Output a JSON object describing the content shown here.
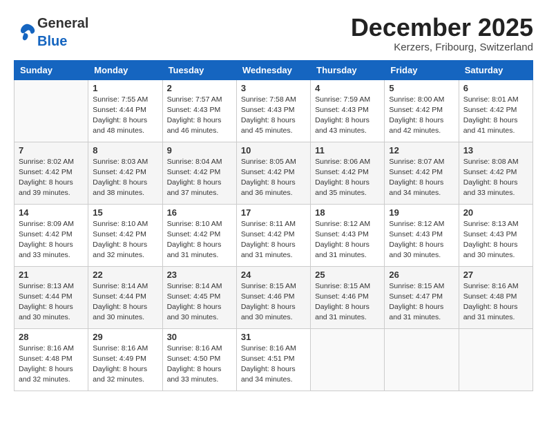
{
  "logo": {
    "general": "General",
    "blue": "Blue"
  },
  "header": {
    "month": "December 2025",
    "location": "Kerzers, Fribourg, Switzerland"
  },
  "weekdays": [
    "Sunday",
    "Monday",
    "Tuesday",
    "Wednesday",
    "Thursday",
    "Friday",
    "Saturday"
  ],
  "weeks": [
    [
      {
        "day": "",
        "sunrise": "",
        "sunset": "",
        "daylight": ""
      },
      {
        "day": "1",
        "sunrise": "Sunrise: 7:55 AM",
        "sunset": "Sunset: 4:44 PM",
        "daylight": "Daylight: 8 hours and 48 minutes."
      },
      {
        "day": "2",
        "sunrise": "Sunrise: 7:57 AM",
        "sunset": "Sunset: 4:43 PM",
        "daylight": "Daylight: 8 hours and 46 minutes."
      },
      {
        "day": "3",
        "sunrise": "Sunrise: 7:58 AM",
        "sunset": "Sunset: 4:43 PM",
        "daylight": "Daylight: 8 hours and 45 minutes."
      },
      {
        "day": "4",
        "sunrise": "Sunrise: 7:59 AM",
        "sunset": "Sunset: 4:43 PM",
        "daylight": "Daylight: 8 hours and 43 minutes."
      },
      {
        "day": "5",
        "sunrise": "Sunrise: 8:00 AM",
        "sunset": "Sunset: 4:42 PM",
        "daylight": "Daylight: 8 hours and 42 minutes."
      },
      {
        "day": "6",
        "sunrise": "Sunrise: 8:01 AM",
        "sunset": "Sunset: 4:42 PM",
        "daylight": "Daylight: 8 hours and 41 minutes."
      }
    ],
    [
      {
        "day": "7",
        "sunrise": "Sunrise: 8:02 AM",
        "sunset": "Sunset: 4:42 PM",
        "daylight": "Daylight: 8 hours and 39 minutes."
      },
      {
        "day": "8",
        "sunrise": "Sunrise: 8:03 AM",
        "sunset": "Sunset: 4:42 PM",
        "daylight": "Daylight: 8 hours and 38 minutes."
      },
      {
        "day": "9",
        "sunrise": "Sunrise: 8:04 AM",
        "sunset": "Sunset: 4:42 PM",
        "daylight": "Daylight: 8 hours and 37 minutes."
      },
      {
        "day": "10",
        "sunrise": "Sunrise: 8:05 AM",
        "sunset": "Sunset: 4:42 PM",
        "daylight": "Daylight: 8 hours and 36 minutes."
      },
      {
        "day": "11",
        "sunrise": "Sunrise: 8:06 AM",
        "sunset": "Sunset: 4:42 PM",
        "daylight": "Daylight: 8 hours and 35 minutes."
      },
      {
        "day": "12",
        "sunrise": "Sunrise: 8:07 AM",
        "sunset": "Sunset: 4:42 PM",
        "daylight": "Daylight: 8 hours and 34 minutes."
      },
      {
        "day": "13",
        "sunrise": "Sunrise: 8:08 AM",
        "sunset": "Sunset: 4:42 PM",
        "daylight": "Daylight: 8 hours and 33 minutes."
      }
    ],
    [
      {
        "day": "14",
        "sunrise": "Sunrise: 8:09 AM",
        "sunset": "Sunset: 4:42 PM",
        "daylight": "Daylight: 8 hours and 33 minutes."
      },
      {
        "day": "15",
        "sunrise": "Sunrise: 8:10 AM",
        "sunset": "Sunset: 4:42 PM",
        "daylight": "Daylight: 8 hours and 32 minutes."
      },
      {
        "day": "16",
        "sunrise": "Sunrise: 8:10 AM",
        "sunset": "Sunset: 4:42 PM",
        "daylight": "Daylight: 8 hours and 31 minutes."
      },
      {
        "day": "17",
        "sunrise": "Sunrise: 8:11 AM",
        "sunset": "Sunset: 4:42 PM",
        "daylight": "Daylight: 8 hours and 31 minutes."
      },
      {
        "day": "18",
        "sunrise": "Sunrise: 8:12 AM",
        "sunset": "Sunset: 4:43 PM",
        "daylight": "Daylight: 8 hours and 31 minutes."
      },
      {
        "day": "19",
        "sunrise": "Sunrise: 8:12 AM",
        "sunset": "Sunset: 4:43 PM",
        "daylight": "Daylight: 8 hours and 30 minutes."
      },
      {
        "day": "20",
        "sunrise": "Sunrise: 8:13 AM",
        "sunset": "Sunset: 4:43 PM",
        "daylight": "Daylight: 8 hours and 30 minutes."
      }
    ],
    [
      {
        "day": "21",
        "sunrise": "Sunrise: 8:13 AM",
        "sunset": "Sunset: 4:44 PM",
        "daylight": "Daylight: 8 hours and 30 minutes."
      },
      {
        "day": "22",
        "sunrise": "Sunrise: 8:14 AM",
        "sunset": "Sunset: 4:44 PM",
        "daylight": "Daylight: 8 hours and 30 minutes."
      },
      {
        "day": "23",
        "sunrise": "Sunrise: 8:14 AM",
        "sunset": "Sunset: 4:45 PM",
        "daylight": "Daylight: 8 hours and 30 minutes."
      },
      {
        "day": "24",
        "sunrise": "Sunrise: 8:15 AM",
        "sunset": "Sunset: 4:46 PM",
        "daylight": "Daylight: 8 hours and 30 minutes."
      },
      {
        "day": "25",
        "sunrise": "Sunrise: 8:15 AM",
        "sunset": "Sunset: 4:46 PM",
        "daylight": "Daylight: 8 hours and 31 minutes."
      },
      {
        "day": "26",
        "sunrise": "Sunrise: 8:15 AM",
        "sunset": "Sunset: 4:47 PM",
        "daylight": "Daylight: 8 hours and 31 minutes."
      },
      {
        "day": "27",
        "sunrise": "Sunrise: 8:16 AM",
        "sunset": "Sunset: 4:48 PM",
        "daylight": "Daylight: 8 hours and 31 minutes."
      }
    ],
    [
      {
        "day": "28",
        "sunrise": "Sunrise: 8:16 AM",
        "sunset": "Sunset: 4:48 PM",
        "daylight": "Daylight: 8 hours and 32 minutes."
      },
      {
        "day": "29",
        "sunrise": "Sunrise: 8:16 AM",
        "sunset": "Sunset: 4:49 PM",
        "daylight": "Daylight: 8 hours and 32 minutes."
      },
      {
        "day": "30",
        "sunrise": "Sunrise: 8:16 AM",
        "sunset": "Sunset: 4:50 PM",
        "daylight": "Daylight: 8 hours and 33 minutes."
      },
      {
        "day": "31",
        "sunrise": "Sunrise: 8:16 AM",
        "sunset": "Sunset: 4:51 PM",
        "daylight": "Daylight: 8 hours and 34 minutes."
      },
      {
        "day": "",
        "sunrise": "",
        "sunset": "",
        "daylight": ""
      },
      {
        "day": "",
        "sunrise": "",
        "sunset": "",
        "daylight": ""
      },
      {
        "day": "",
        "sunrise": "",
        "sunset": "",
        "daylight": ""
      }
    ]
  ]
}
